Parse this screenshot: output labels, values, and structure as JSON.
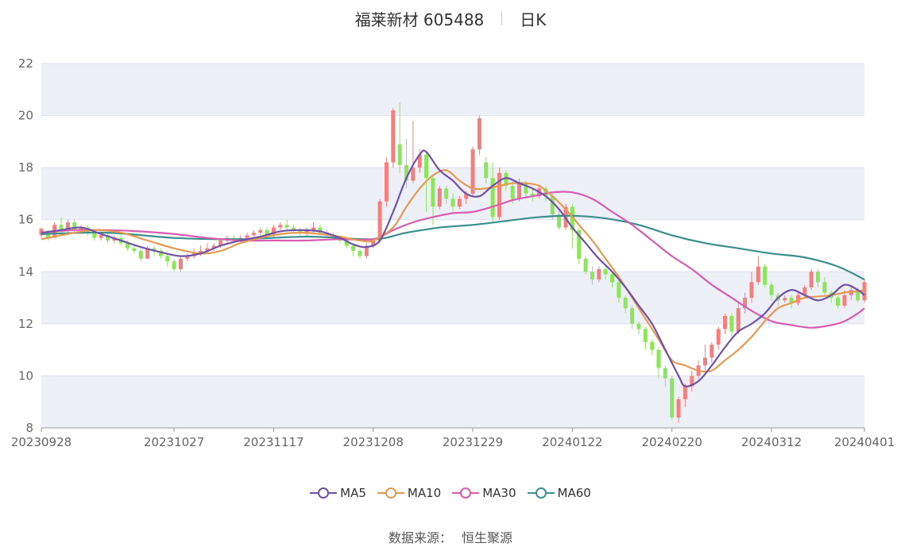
{
  "header": {
    "title": "福莱新材 605488",
    "period": "日K"
  },
  "source": {
    "label": "数据来源：",
    "name": "恒生聚源"
  },
  "colors": {
    "up": "#f47f7f",
    "down": "#8ce65a",
    "ma5": "#7151a8",
    "ma10": "#e59a52",
    "ma30": "#d95cb0",
    "ma60": "#3a8f8c",
    "band": "#eef0f8",
    "axis": "#999999"
  },
  "chart_data": {
    "type": "candlestick",
    "ylim": [
      8,
      22
    ],
    "yticks": [
      8,
      10,
      12,
      14,
      16,
      18,
      20,
      22
    ],
    "xtick_labels": [
      "20230928",
      "20231027",
      "20231117",
      "20231208",
      "20231229",
      "20240122",
      "20240220",
      "20240312",
      "20240401"
    ],
    "xtick_index": [
      0,
      20,
      35,
      50,
      65,
      80,
      95,
      110,
      124
    ],
    "n": 125,
    "candles": [
      [
        15.4,
        15.65,
        15.3,
        15.7
      ],
      [
        15.5,
        15.3,
        15.2,
        15.6
      ],
      [
        15.3,
        15.8,
        15.3,
        15.9
      ],
      [
        15.8,
        15.6,
        15.5,
        16.1
      ],
      [
        15.6,
        15.9,
        15.5,
        16.0
      ],
      [
        15.9,
        15.6,
        15.5,
        16.0
      ],
      [
        15.6,
        15.7,
        15.5,
        15.8
      ],
      [
        15.7,
        15.5,
        15.4,
        15.8
      ],
      [
        15.5,
        15.3,
        15.2,
        15.6
      ],
      [
        15.3,
        15.4,
        15.2,
        15.5
      ],
      [
        15.4,
        15.2,
        15.1,
        15.5
      ],
      [
        15.2,
        15.3,
        15.1,
        15.4
      ],
      [
        15.3,
        15.1,
        15.0,
        15.4
      ],
      [
        15.1,
        14.9,
        14.8,
        15.2
      ],
      [
        14.9,
        14.8,
        14.7,
        15.0
      ],
      [
        14.8,
        14.5,
        14.4,
        14.9
      ],
      [
        14.5,
        14.9,
        14.5,
        15.0
      ],
      [
        14.9,
        14.8,
        14.6,
        15.0
      ],
      [
        14.8,
        14.6,
        14.5,
        14.9
      ],
      [
        14.6,
        14.4,
        14.2,
        14.7
      ],
      [
        14.4,
        14.1,
        14.0,
        14.5
      ],
      [
        14.1,
        14.5,
        14.0,
        14.6
      ],
      [
        14.5,
        14.6,
        14.4,
        14.7
      ],
      [
        14.6,
        14.7,
        14.5,
        14.9
      ],
      [
        14.7,
        14.8,
        14.6,
        15.0
      ],
      [
        14.8,
        14.9,
        14.7,
        15.1
      ],
      [
        14.9,
        15.0,
        14.8,
        15.1
      ],
      [
        15.0,
        15.2,
        14.9,
        15.3
      ],
      [
        15.2,
        15.3,
        15.1,
        15.4
      ],
      [
        15.3,
        15.2,
        15.1,
        15.4
      ],
      [
        15.2,
        15.3,
        15.1,
        15.4
      ],
      [
        15.3,
        15.4,
        15.2,
        15.5
      ],
      [
        15.4,
        15.5,
        15.3,
        15.6
      ],
      [
        15.5,
        15.6,
        15.4,
        15.7
      ],
      [
        15.6,
        15.4,
        15.3,
        15.7
      ],
      [
        15.4,
        15.7,
        15.3,
        15.8
      ],
      [
        15.7,
        15.8,
        15.6,
        15.9
      ],
      [
        15.8,
        15.7,
        15.6,
        16.0
      ],
      [
        15.7,
        15.6,
        15.5,
        15.8
      ],
      [
        15.6,
        15.5,
        15.4,
        15.7
      ],
      [
        15.5,
        15.6,
        15.4,
        15.7
      ],
      [
        15.6,
        15.7,
        15.5,
        15.9
      ],
      [
        15.7,
        15.5,
        15.4,
        15.8
      ],
      [
        15.5,
        15.4,
        15.3,
        15.6
      ],
      [
        15.4,
        15.3,
        15.2,
        15.5
      ],
      [
        15.3,
        15.2,
        15.1,
        15.4
      ],
      [
        15.2,
        15.0,
        14.9,
        15.3
      ],
      [
        15.0,
        14.8,
        14.6,
        15.1
      ],
      [
        14.8,
        14.6,
        14.5,
        14.9
      ],
      [
        14.6,
        15.0,
        14.5,
        15.1
      ],
      [
        15.0,
        15.2,
        14.9,
        15.3
      ],
      [
        15.2,
        16.7,
        15.1,
        16.8
      ],
      [
        16.7,
        18.2,
        16.5,
        18.4
      ],
      [
        18.2,
        20.2,
        18.0,
        20.3
      ],
      [
        18.9,
        18.1,
        17.8,
        20.5
      ],
      [
        18.1,
        17.5,
        17.2,
        19.1
      ],
      [
        17.5,
        18.0,
        17.4,
        19.8
      ],
      [
        18.0,
        18.5,
        17.8,
        18.7
      ],
      [
        18.5,
        17.6,
        16.3,
        18.6
      ],
      [
        17.6,
        16.5,
        15.8,
        17.7
      ],
      [
        16.5,
        17.2,
        16.4,
        17.3
      ],
      [
        17.2,
        16.8,
        16.6,
        17.3
      ],
      [
        16.8,
        16.5,
        16.3,
        17.0
      ],
      [
        16.5,
        16.8,
        16.4,
        16.9
      ],
      [
        16.8,
        17.0,
        16.6,
        17.1
      ],
      [
        17.0,
        18.7,
        16.9,
        18.8
      ],
      [
        18.7,
        19.9,
        18.5,
        20.0
      ],
      [
        18.2,
        17.6,
        17.4,
        18.4
      ],
      [
        17.6,
        16.1,
        15.9,
        18.2
      ],
      [
        16.1,
        17.8,
        16.0,
        18.0
      ],
      [
        17.8,
        17.3,
        17.1,
        17.9
      ],
      [
        17.3,
        16.8,
        16.6,
        17.5
      ],
      [
        16.8,
        17.4,
        16.7,
        17.6
      ],
      [
        17.4,
        17.0,
        16.8,
        17.5
      ],
      [
        17.0,
        16.9,
        16.7,
        17.2
      ],
      [
        16.9,
        17.2,
        16.8,
        17.3
      ],
      [
        17.2,
        16.9,
        16.7,
        17.3
      ],
      [
        16.9,
        16.2,
        16.0,
        17.0
      ],
      [
        16.2,
        15.7,
        15.6,
        16.4
      ],
      [
        15.7,
        16.5,
        15.6,
        16.6
      ],
      [
        16.5,
        15.6,
        14.9,
        16.6
      ],
      [
        15.6,
        14.5,
        14.3,
        15.7
      ],
      [
        14.5,
        14.0,
        13.9,
        14.6
      ],
      [
        14.0,
        13.7,
        13.5,
        14.2
      ],
      [
        13.7,
        14.1,
        13.6,
        14.2
      ],
      [
        14.1,
        13.9,
        13.7,
        14.2
      ],
      [
        13.9,
        13.6,
        13.4,
        14.0
      ],
      [
        13.6,
        13.0,
        12.8,
        13.7
      ],
      [
        13.0,
        12.6,
        12.4,
        13.1
      ],
      [
        12.6,
        12.0,
        11.8,
        12.7
      ],
      [
        12.0,
        11.8,
        11.6,
        12.1
      ],
      [
        11.8,
        11.3,
        11.0,
        11.9
      ],
      [
        11.3,
        11.0,
        10.8,
        11.4
      ],
      [
        11.0,
        10.3,
        9.9,
        11.1
      ],
      [
        10.3,
        9.9,
        9.6,
        10.4
      ],
      [
        9.9,
        8.4,
        8.3,
        10.0
      ],
      [
        8.4,
        9.1,
        8.2,
        9.2
      ],
      [
        9.1,
        9.6,
        8.8,
        9.7
      ],
      [
        9.6,
        10.0,
        9.4,
        10.2
      ],
      [
        10.0,
        10.4,
        9.9,
        10.6
      ],
      [
        10.4,
        10.7,
        10.2,
        11.2
      ],
      [
        10.7,
        11.2,
        10.5,
        11.3
      ],
      [
        11.2,
        11.8,
        11.0,
        11.9
      ],
      [
        11.8,
        12.3,
        11.6,
        12.4
      ],
      [
        12.3,
        11.7,
        11.5,
        12.4
      ],
      [
        11.7,
        12.6,
        11.6,
        12.8
      ],
      [
        12.6,
        13.0,
        12.4,
        13.2
      ],
      [
        13.0,
        13.6,
        12.8,
        14.0
      ],
      [
        13.6,
        14.2,
        13.5,
        14.6
      ],
      [
        14.2,
        13.5,
        13.4,
        14.3
      ],
      [
        13.5,
        13.1,
        12.9,
        13.6
      ],
      [
        13.1,
        12.9,
        12.7,
        13.2
      ],
      [
        12.9,
        13.0,
        12.8,
        13.1
      ],
      [
        13.0,
        12.8,
        12.6,
        13.1
      ],
      [
        12.8,
        13.1,
        12.7,
        13.2
      ],
      [
        13.1,
        13.4,
        13.0,
        13.5
      ],
      [
        13.4,
        14.0,
        13.3,
        14.1
      ],
      [
        14.0,
        13.6,
        13.4,
        14.1
      ],
      [
        13.6,
        13.2,
        13.1,
        13.8
      ],
      [
        13.2,
        13.0,
        12.8,
        13.3
      ],
      [
        13.0,
        12.7,
        12.6,
        13.1
      ],
      [
        12.7,
        13.1,
        12.6,
        13.3
      ],
      [
        13.1,
        13.3,
        12.9,
        13.4
      ],
      [
        13.3,
        12.9,
        12.8,
        13.4
      ],
      [
        12.9,
        13.6,
        12.8,
        13.7
      ]
    ],
    "series": [
      {
        "name": "MA5",
        "points": [
          [
            0,
            15.5
          ],
          [
            3,
            15.6
          ],
          [
            6,
            15.7
          ],
          [
            9,
            15.45
          ],
          [
            12,
            15.2
          ],
          [
            15,
            14.95
          ],
          [
            18,
            14.75
          ],
          [
            21,
            14.6
          ],
          [
            24,
            14.7
          ],
          [
            27,
            15.0
          ],
          [
            30,
            15.2
          ],
          [
            33,
            15.35
          ],
          [
            36,
            15.55
          ],
          [
            39,
            15.6
          ],
          [
            42,
            15.55
          ],
          [
            45,
            15.3
          ],
          [
            47,
            15.05
          ],
          [
            49,
            14.95
          ],
          [
            51,
            15.2
          ],
          [
            53,
            16.3
          ],
          [
            55,
            17.6
          ],
          [
            57,
            18.5
          ],
          [
            58,
            18.6
          ],
          [
            60,
            17.9
          ],
          [
            62,
            17.5
          ],
          [
            64,
            17.0
          ],
          [
            66,
            16.9
          ],
          [
            68,
            17.3
          ],
          [
            70,
            17.6
          ],
          [
            72,
            17.4
          ],
          [
            74,
            17.2
          ],
          [
            76,
            16.9
          ],
          [
            78,
            16.4
          ],
          [
            80,
            15.7
          ],
          [
            82,
            15.1
          ],
          [
            84,
            14.5
          ],
          [
            86,
            14.0
          ],
          [
            88,
            13.4
          ],
          [
            90,
            12.7
          ],
          [
            92,
            12.0
          ],
          [
            94,
            11.0
          ],
          [
            96,
            10.0
          ],
          [
            97,
            9.6
          ],
          [
            99,
            9.8
          ],
          [
            101,
            10.4
          ],
          [
            103,
            11.1
          ],
          [
            105,
            11.7
          ],
          [
            107,
            12.0
          ],
          [
            109,
            12.4
          ],
          [
            111,
            13.0
          ],
          [
            113,
            13.3
          ],
          [
            115,
            13.1
          ],
          [
            117,
            12.9
          ],
          [
            119,
            13.1
          ],
          [
            121,
            13.5
          ],
          [
            123,
            13.3
          ],
          [
            124,
            13.1
          ]
        ]
      },
      {
        "name": "MA10",
        "points": [
          [
            0,
            15.25
          ],
          [
            4,
            15.45
          ],
          [
            8,
            15.6
          ],
          [
            12,
            15.5
          ],
          [
            16,
            15.2
          ],
          [
            20,
            14.9
          ],
          [
            24,
            14.7
          ],
          [
            27,
            14.8
          ],
          [
            30,
            15.1
          ],
          [
            33,
            15.3
          ],
          [
            36,
            15.45
          ],
          [
            39,
            15.5
          ],
          [
            42,
            15.45
          ],
          [
            45,
            15.35
          ],
          [
            48,
            15.2
          ],
          [
            50,
            15.2
          ],
          [
            53,
            15.7
          ],
          [
            55,
            16.5
          ],
          [
            57,
            17.2
          ],
          [
            59,
            17.7
          ],
          [
            61,
            17.9
          ],
          [
            63,
            17.5
          ],
          [
            65,
            17.2
          ],
          [
            67,
            17.2
          ],
          [
            69,
            17.3
          ],
          [
            71,
            17.4
          ],
          [
            73,
            17.4
          ],
          [
            75,
            17.3
          ],
          [
            77,
            16.9
          ],
          [
            79,
            16.4
          ],
          [
            81,
            15.8
          ],
          [
            83,
            15.2
          ],
          [
            85,
            14.5
          ],
          [
            87,
            13.8
          ],
          [
            89,
            13.0
          ],
          [
            91,
            12.2
          ],
          [
            93,
            11.4
          ],
          [
            95,
            10.6
          ],
          [
            97,
            10.4
          ],
          [
            99,
            10.2
          ],
          [
            101,
            10.2
          ],
          [
            103,
            10.6
          ],
          [
            105,
            11.0
          ],
          [
            107,
            11.5
          ],
          [
            109,
            12.1
          ],
          [
            111,
            12.6
          ],
          [
            113,
            12.8
          ],
          [
            115,
            13.0
          ],
          [
            117,
            13.05
          ],
          [
            119,
            13.1
          ],
          [
            121,
            13.2
          ],
          [
            123,
            13.25
          ],
          [
            124,
            13.3
          ]
        ]
      },
      {
        "name": "MA30",
        "points": [
          [
            0,
            15.5
          ],
          [
            5,
            15.6
          ],
          [
            10,
            15.6
          ],
          [
            15,
            15.55
          ],
          [
            20,
            15.45
          ],
          [
            25,
            15.3
          ],
          [
            30,
            15.2
          ],
          [
            35,
            15.2
          ],
          [
            40,
            15.2
          ],
          [
            45,
            15.25
          ],
          [
            50,
            15.25
          ],
          [
            53,
            15.6
          ],
          [
            56,
            15.9
          ],
          [
            59,
            16.1
          ],
          [
            62,
            16.25
          ],
          [
            65,
            16.3
          ],
          [
            68,
            16.5
          ],
          [
            71,
            16.75
          ],
          [
            74,
            16.9
          ],
          [
            77,
            17.05
          ],
          [
            80,
            17.05
          ],
          [
            83,
            16.8
          ],
          [
            86,
            16.3
          ],
          [
            89,
            15.8
          ],
          [
            92,
            15.2
          ],
          [
            95,
            14.6
          ],
          [
            98,
            14.1
          ],
          [
            101,
            13.5
          ],
          [
            104,
            13.0
          ],
          [
            107,
            12.5
          ],
          [
            110,
            12.1
          ],
          [
            113,
            11.95
          ],
          [
            116,
            11.85
          ],
          [
            119,
            11.95
          ],
          [
            121,
            12.1
          ],
          [
            123,
            12.4
          ],
          [
            124,
            12.6
          ]
        ]
      },
      {
        "name": "MA60",
        "points": [
          [
            0,
            15.45
          ],
          [
            10,
            15.5
          ],
          [
            20,
            15.3
          ],
          [
            30,
            15.25
          ],
          [
            40,
            15.35
          ],
          [
            50,
            15.25
          ],
          [
            55,
            15.5
          ],
          [
            60,
            15.7
          ],
          [
            65,
            15.8
          ],
          [
            70,
            15.95
          ],
          [
            75,
            16.1
          ],
          [
            80,
            16.15
          ],
          [
            85,
            16.05
          ],
          [
            90,
            15.8
          ],
          [
            95,
            15.4
          ],
          [
            100,
            15.1
          ],
          [
            105,
            14.9
          ],
          [
            110,
            14.7
          ],
          [
            115,
            14.55
          ],
          [
            120,
            14.2
          ],
          [
            124,
            13.7
          ]
        ]
      }
    ]
  }
}
